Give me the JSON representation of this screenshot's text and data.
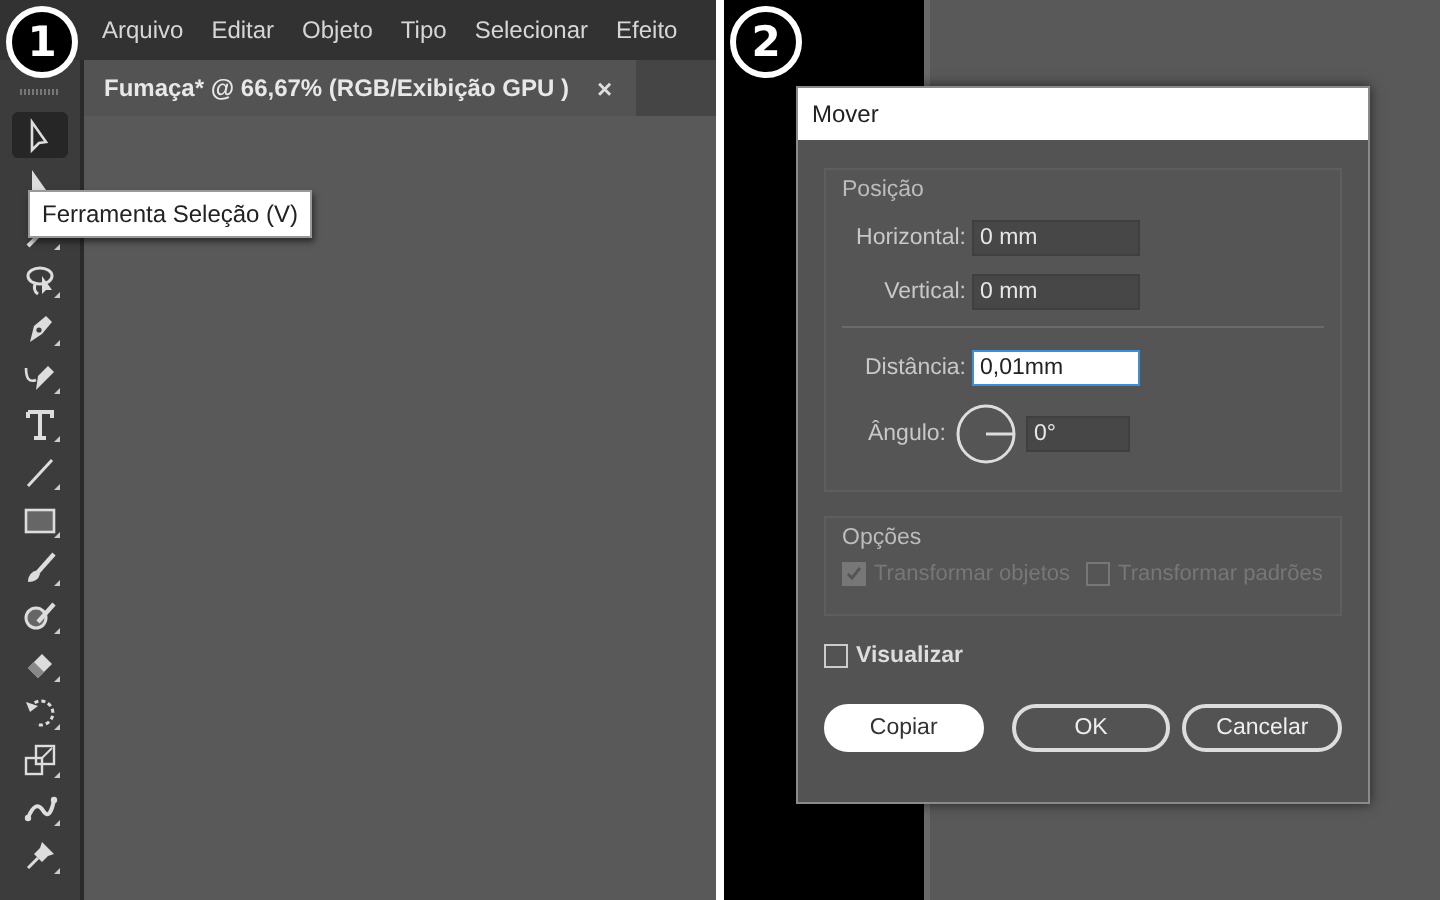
{
  "step_badges": [
    "1",
    "2"
  ],
  "menu": [
    "Arquivo",
    "Editar",
    "Objeto",
    "Tipo",
    "Selecionar",
    "Efeito"
  ],
  "document_tab": {
    "title": "Fumaça* @ 66,67% (RGB/Exibição GPU )",
    "close": "×"
  },
  "tools": [
    {
      "selected": true
    },
    {
      "selected": false
    },
    {
      "selected": false
    },
    {
      "selected": false
    },
    {
      "selected": false
    },
    {
      "selected": false
    },
    {
      "selected": false
    },
    {
      "selected": false
    },
    {
      "selected": false
    },
    {
      "selected": false
    },
    {
      "selected": false
    },
    {
      "selected": false
    },
    {
      "selected": false
    },
    {
      "selected": false
    },
    {
      "selected": false
    },
    {
      "selected": false
    }
  ],
  "tooltip": "Ferramenta Seleção (V)",
  "dialog": {
    "title": "Mover",
    "position_group": {
      "title": "Posição",
      "fields": [
        {
          "label": "Horizontal:",
          "value": "0 mm",
          "focused": false
        },
        {
          "label": "Vertical:",
          "value": "0 mm",
          "focused": false
        }
      ],
      "distance": {
        "label": "Distância:",
        "value": "0,01mm",
        "focused": true
      },
      "angle": {
        "label": "Ângulo:",
        "value": "0°"
      }
    },
    "options_group": {
      "title": "Opções",
      "disabled": true,
      "checkboxes": [
        {
          "label": "Transformar objetos",
          "checked": true
        },
        {
          "label": "Transformar padrões",
          "checked": false
        }
      ]
    },
    "preview": {
      "label": "Visualizar",
      "checked": false
    },
    "buttons": [
      {
        "label": "Copiar",
        "kind": "primary"
      },
      {
        "label": "OK",
        "kind": "outline"
      },
      {
        "label": "Cancelar",
        "kind": "outline"
      }
    ]
  }
}
